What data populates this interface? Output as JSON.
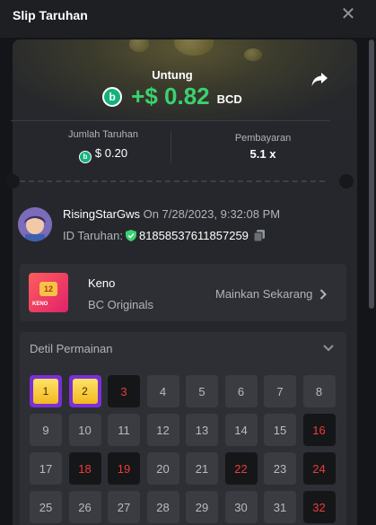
{
  "header": {
    "title": "Slip Taruhan",
    "close_icon": "close-icon"
  },
  "result": {
    "label": "Untung",
    "amount": "+$ 0.82",
    "currency": "BCD",
    "icon_letter": "b",
    "share_icon": "share-icon"
  },
  "stats": {
    "bet_label": "Jumlah Taruhan",
    "bet_value": "$ 0.20",
    "payout_label": "Pembayaran",
    "payout_value": "5.1 x"
  },
  "bet_info": {
    "username": "RisingStarGws",
    "date_text": "On 7/28/2023, 9:32:08 PM",
    "id_label": "ID Taruhan:",
    "id_value": "81858537611857259"
  },
  "game": {
    "name": "Keno",
    "provider": "BC Originals",
    "play_label": "Mainkan Sekarang",
    "thumb_label": "KENO"
  },
  "details": {
    "title": "Detil Permainan",
    "tiles": [
      {
        "n": "1",
        "s": "hit"
      },
      {
        "n": "2",
        "s": "hit"
      },
      {
        "n": "3",
        "s": "miss"
      },
      {
        "n": "4",
        "s": "none"
      },
      {
        "n": "5",
        "s": "none"
      },
      {
        "n": "6",
        "s": "none"
      },
      {
        "n": "7",
        "s": "none"
      },
      {
        "n": "8",
        "s": "none"
      },
      {
        "n": "9",
        "s": "none"
      },
      {
        "n": "10",
        "s": "none"
      },
      {
        "n": "11",
        "s": "none"
      },
      {
        "n": "12",
        "s": "none"
      },
      {
        "n": "13",
        "s": "none"
      },
      {
        "n": "14",
        "s": "none"
      },
      {
        "n": "15",
        "s": "none"
      },
      {
        "n": "16",
        "s": "miss"
      },
      {
        "n": "17",
        "s": "none"
      },
      {
        "n": "18",
        "s": "miss"
      },
      {
        "n": "19",
        "s": "miss"
      },
      {
        "n": "20",
        "s": "none"
      },
      {
        "n": "21",
        "s": "none"
      },
      {
        "n": "22",
        "s": "miss"
      },
      {
        "n": "23",
        "s": "none"
      },
      {
        "n": "24",
        "s": "miss"
      },
      {
        "n": "25",
        "s": "none"
      },
      {
        "n": "26",
        "s": "none"
      },
      {
        "n": "27",
        "s": "none"
      },
      {
        "n": "28",
        "s": "none"
      },
      {
        "n": "29",
        "s": "none"
      },
      {
        "n": "30",
        "s": "none"
      },
      {
        "n": "31",
        "s": "none"
      },
      {
        "n": "32",
        "s": "miss"
      }
    ]
  },
  "colors": {
    "accent_green": "#3bd16f",
    "miss_red": "#ee3b3b",
    "hit_purple": "#7b2fd6"
  }
}
